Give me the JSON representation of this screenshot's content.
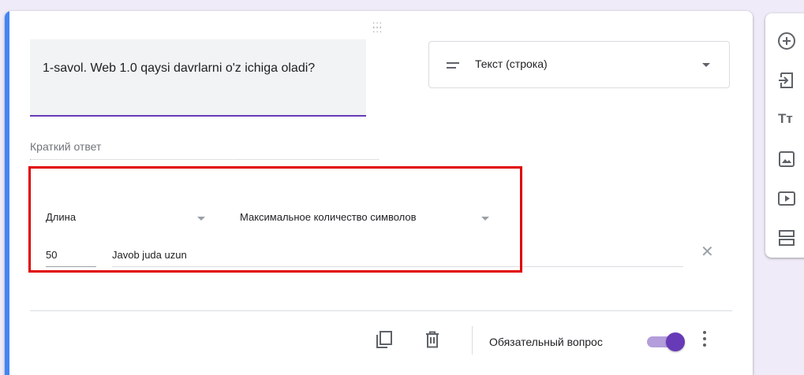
{
  "question": {
    "title": "1-savol. Web 1.0 qaysi davrlarni o'z ichiga oladi?",
    "type_select": {
      "icon": "short-text-icon",
      "label": "Текст (строка)"
    },
    "answer_placeholder": "Краткий ответ"
  },
  "validation": {
    "type_dropdown": "Длина",
    "rule_dropdown": "Максимальное количество символов",
    "number_value": "50",
    "error_text": "Javob juda uzun"
  },
  "footer": {
    "required_label": "Обязательный вопрос",
    "required_on": true
  },
  "toolbar": {
    "items": [
      "add-question-icon",
      "import-questions-icon",
      "add-title-icon",
      "add-image-icon",
      "add-video-icon",
      "add-section-icon"
    ]
  },
  "colors": {
    "accent": "#673ab7",
    "card_left_bar": "#4285f4",
    "highlight_box": "#e00000",
    "background": "#f0ebf8"
  }
}
